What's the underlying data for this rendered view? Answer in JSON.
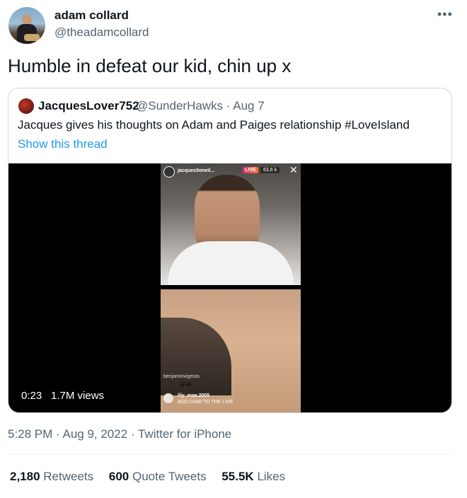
{
  "author": {
    "display_name": "adam collard",
    "handle": "@theadamcollard"
  },
  "more_icon": "more-horizontal-icon",
  "tweet_text": "Humble in defeat our kid, chin up x",
  "quoted_tweet": {
    "display_name": "JacquesLover752",
    "handle_date": "@SunderHawks · Aug 7",
    "text": "Jacques gives his thoughts on Adam and Paiges relationship #LoveIsland",
    "show_thread": "Show this thread",
    "video": {
      "time": "0:23",
      "views": "1.7M views",
      "overlay": {
        "username": "jacques0oneil...",
        "live_badge": "LIVE",
        "viewer_count": "63,6 k",
        "comment1_user": "benjaminvigeras",
        "comment1_emoji": "😂😂",
        "comment2_user": "lily_mae.2005",
        "comment2_text": "ADD DAMI TO THE LIVE"
      }
    }
  },
  "timestamp": "5:28 PM · Aug 9, 2022 · Twitter for iPhone",
  "stats": {
    "retweets_count": "2,180",
    "retweets_label": "Retweets",
    "quotes_count": "600",
    "quotes_label": "Quote Tweets",
    "likes_count": "55.5K",
    "likes_label": "Likes"
  },
  "colors": {
    "link": "#1d9bf0",
    "secondary_text": "#536471",
    "border": "#cfd9de"
  }
}
